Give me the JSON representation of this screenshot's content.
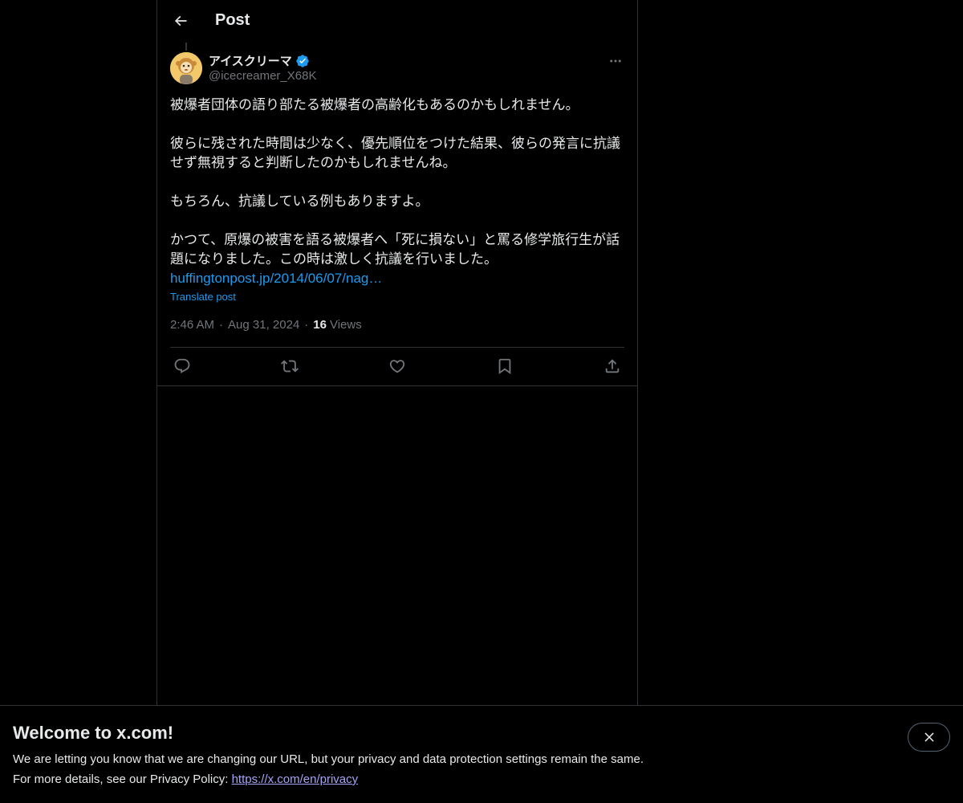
{
  "header": {
    "title": "Post"
  },
  "post": {
    "author": {
      "name": "アイスクリーマ",
      "handle": "@icecreamer_X68K",
      "verified": true
    },
    "text": "被爆者団体の語り部たる被爆者の高齢化もあるのかもしれません。\n\n彼らに残された時間は少なく、優先順位をつけた結果、彼らの発言に抗議せず無視すると判断したのかもしれませんね。\n\nもちろん、抗議している例もありますよ。\n\nかつて、原爆の被害を語る被爆者へ「死に損ない」と罵る修学旅行生が話題になりました。この時は激しく抗議を行いました。",
    "link": "huffingtonpost.jp/2014/06/07/nag…",
    "translate_label": "Translate post",
    "time": "2:46 AM",
    "date": "Aug 31, 2024",
    "separator": "·",
    "views_count": "16",
    "views_label": "Views"
  },
  "actions": {
    "icons": [
      "reply-icon",
      "repost-icon",
      "like-icon",
      "bookmark-icon",
      "share-icon"
    ]
  },
  "banner": {
    "title": "Welcome to x.com!",
    "line1": "We are letting you know that we are changing our URL, but your privacy and data protection settings remain the same.",
    "line2_prefix": "For more details, see our Privacy Policy: ",
    "link": "https://x.com/en/privacy"
  },
  "colors": {
    "background": "#000000",
    "text": "#e7e9ea",
    "secondary": "#71767b",
    "accent": "#1d9bf0",
    "border": "#2f3336",
    "banner_link": "#a8a4f5"
  }
}
